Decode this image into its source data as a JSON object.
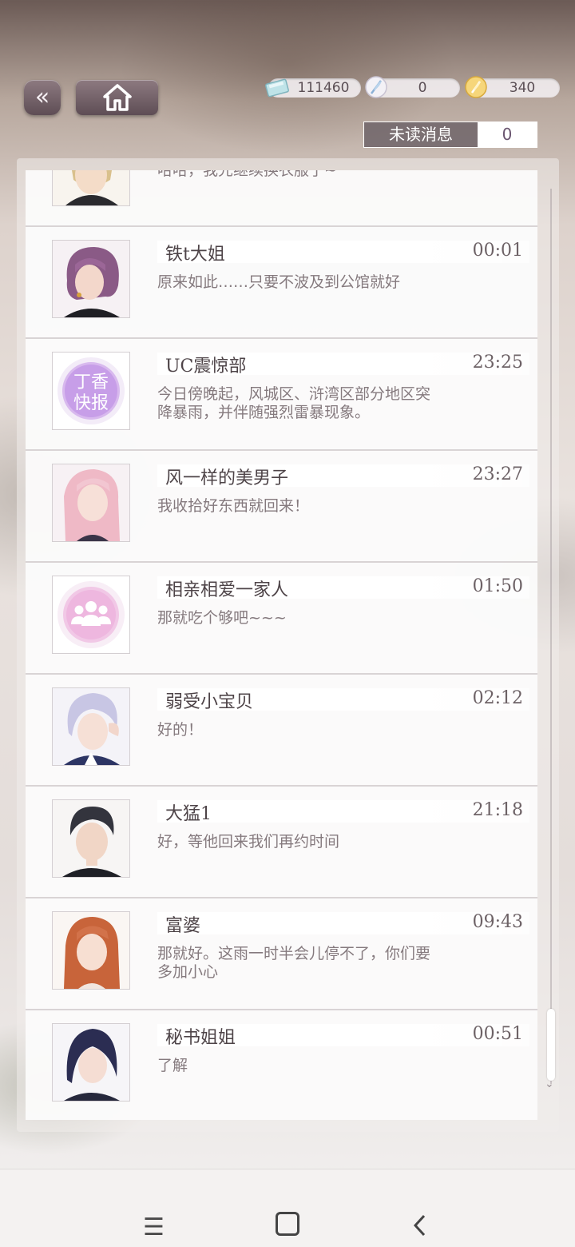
{
  "topbar": {
    "back_label": "«",
    "currencies": [
      {
        "icon": "ticket-icon",
        "value": "111460"
      },
      {
        "icon": "feather-icon",
        "value": "0"
      },
      {
        "icon": "gold-coin-icon",
        "value": "340"
      }
    ],
    "unread_label": "未读消息",
    "unread_count": "0"
  },
  "conversations": [
    {
      "name": "",
      "time": "",
      "message": "哈哈，我先继续换衣服了~",
      "avatar": "blonde-man-avatar"
    },
    {
      "name": "铁t大姐",
      "time": "00:01",
      "message": "原来如此……只要不波及到公馆就好",
      "avatar": "purple-hair-woman-avatar"
    },
    {
      "name": "UC震惊部",
      "time": "23:25",
      "message": "今日傍晚起，风城区、浒湾区部分地区突降暴雨，并伴随强烈雷暴现象。",
      "avatar": "news-logo-avatar",
      "logo_text": [
        "丁香",
        "快报"
      ]
    },
    {
      "name": "风一样的美男子",
      "time": "23:27",
      "message": "我收拾好东西就回来！",
      "avatar": "pink-hair-man-avatar"
    },
    {
      "name": "相亲相爱一家人",
      "time": "01:50",
      "message": "那就吃个够吧~~~",
      "avatar": "group-icon-avatar"
    },
    {
      "name": "弱受小宝贝",
      "time": "02:12",
      "message": "好的！",
      "avatar": "silver-hair-man-avatar"
    },
    {
      "name": "大猛1",
      "time": "21:18",
      "message": "好，等他回来我们再约时间",
      "avatar": "dark-hair-man-avatar"
    },
    {
      "name": "富婆",
      "time": "09:43",
      "message": "那就好。这雨一时半会儿停不了，你们要多加小心",
      "avatar": "auburn-hair-woman-avatar"
    },
    {
      "name": "秘书姐姐",
      "time": "00:51",
      "message": "了解",
      "avatar": "navy-hair-woman-avatar"
    }
  ],
  "navbar": {
    "menu_icon": "menu-icon",
    "home_icon": "home-square-icon",
    "back_icon": "back-chevron-icon"
  },
  "colors": {
    "accent": "#6a5570",
    "button": "#6e5c64",
    "panel": "#f5f2f2"
  }
}
